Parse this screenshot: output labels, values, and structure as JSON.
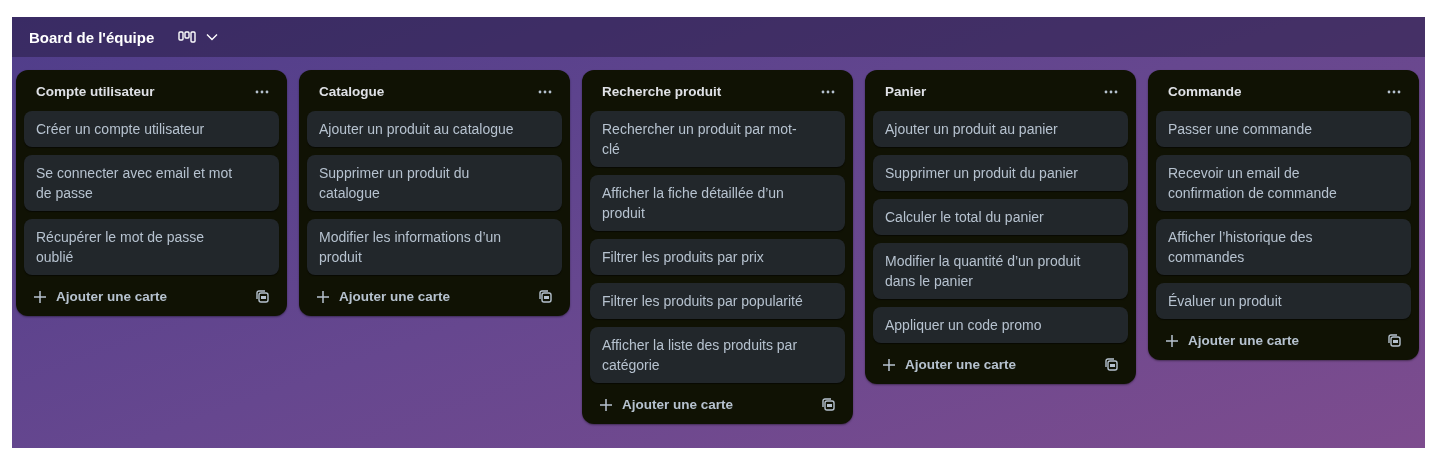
{
  "board": {
    "title": "Board de l'équipe"
  },
  "lists": [
    {
      "title": "Compte utilisateur",
      "cards": [
        "Créer un compte utilisateur",
        "Se connecter avec email et mot de passe",
        "Récupérer le mot de passe oublié"
      ],
      "add_label": "Ajouter une carte"
    },
    {
      "title": "Catalogue",
      "cards": [
        "Ajouter un produit au catalogue",
        "Supprimer un produit du catalogue",
        "Modifier les informations d’un produit"
      ],
      "add_label": "Ajouter une carte"
    },
    {
      "title": "Recherche produit",
      "cards": [
        "Rechercher un produit par mot-clé",
        "Afficher la fiche détaillée d’un produit",
        "Filtrer les produits par prix",
        "Filtrer les produits par popularité",
        "Afficher la liste des produits par catégorie"
      ],
      "add_label": "Ajouter une carte"
    },
    {
      "title": "Panier",
      "cards": [
        "Ajouter un produit au panier",
        "Supprimer un produit du panier",
        "Calculer le total du panier",
        "Modifier la quantité d’un produit dans le panier",
        "Appliquer un code promo"
      ],
      "add_label": "Ajouter une carte"
    },
    {
      "title": "Commande",
      "cards": [
        "Passer une commande",
        "Recevoir un email de confirmation de commande",
        "Afficher l’historique des commandes",
        "Évaluer un produit"
      ],
      "add_label": "Ajouter une carte"
    }
  ]
}
